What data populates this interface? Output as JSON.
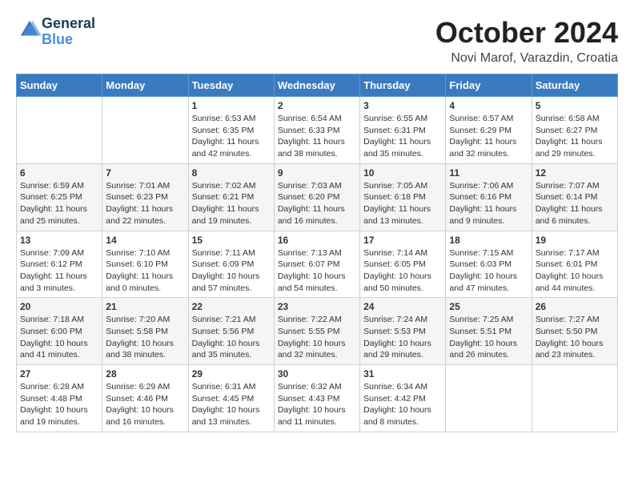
{
  "logo": {
    "text_general": "General",
    "text_blue": "Blue"
  },
  "header": {
    "month": "October 2024",
    "location": "Novi Marof, Varazdin, Croatia"
  },
  "weekdays": [
    "Sunday",
    "Monday",
    "Tuesday",
    "Wednesday",
    "Thursday",
    "Friday",
    "Saturday"
  ],
  "weeks": [
    [
      {
        "day": "",
        "sunrise": "",
        "sunset": "",
        "daylight": ""
      },
      {
        "day": "",
        "sunrise": "",
        "sunset": "",
        "daylight": ""
      },
      {
        "day": "1",
        "sunrise": "Sunrise: 6:53 AM",
        "sunset": "Sunset: 6:35 PM",
        "daylight": "Daylight: 11 hours and 42 minutes."
      },
      {
        "day": "2",
        "sunrise": "Sunrise: 6:54 AM",
        "sunset": "Sunset: 6:33 PM",
        "daylight": "Daylight: 11 hours and 38 minutes."
      },
      {
        "day": "3",
        "sunrise": "Sunrise: 6:55 AM",
        "sunset": "Sunset: 6:31 PM",
        "daylight": "Daylight: 11 hours and 35 minutes."
      },
      {
        "day": "4",
        "sunrise": "Sunrise: 6:57 AM",
        "sunset": "Sunset: 6:29 PM",
        "daylight": "Daylight: 11 hours and 32 minutes."
      },
      {
        "day": "5",
        "sunrise": "Sunrise: 6:58 AM",
        "sunset": "Sunset: 6:27 PM",
        "daylight": "Daylight: 11 hours and 29 minutes."
      }
    ],
    [
      {
        "day": "6",
        "sunrise": "Sunrise: 6:59 AM",
        "sunset": "Sunset: 6:25 PM",
        "daylight": "Daylight: 11 hours and 25 minutes."
      },
      {
        "day": "7",
        "sunrise": "Sunrise: 7:01 AM",
        "sunset": "Sunset: 6:23 PM",
        "daylight": "Daylight: 11 hours and 22 minutes."
      },
      {
        "day": "8",
        "sunrise": "Sunrise: 7:02 AM",
        "sunset": "Sunset: 6:21 PM",
        "daylight": "Daylight: 11 hours and 19 minutes."
      },
      {
        "day": "9",
        "sunrise": "Sunrise: 7:03 AM",
        "sunset": "Sunset: 6:20 PM",
        "daylight": "Daylight: 11 hours and 16 minutes."
      },
      {
        "day": "10",
        "sunrise": "Sunrise: 7:05 AM",
        "sunset": "Sunset: 6:18 PM",
        "daylight": "Daylight: 11 hours and 13 minutes."
      },
      {
        "day": "11",
        "sunrise": "Sunrise: 7:06 AM",
        "sunset": "Sunset: 6:16 PM",
        "daylight": "Daylight: 11 hours and 9 minutes."
      },
      {
        "day": "12",
        "sunrise": "Sunrise: 7:07 AM",
        "sunset": "Sunset: 6:14 PM",
        "daylight": "Daylight: 11 hours and 6 minutes."
      }
    ],
    [
      {
        "day": "13",
        "sunrise": "Sunrise: 7:09 AM",
        "sunset": "Sunset: 6:12 PM",
        "daylight": "Daylight: 11 hours and 3 minutes."
      },
      {
        "day": "14",
        "sunrise": "Sunrise: 7:10 AM",
        "sunset": "Sunset: 6:10 PM",
        "daylight": "Daylight: 11 hours and 0 minutes."
      },
      {
        "day": "15",
        "sunrise": "Sunrise: 7:11 AM",
        "sunset": "Sunset: 6:09 PM",
        "daylight": "Daylight: 10 hours and 57 minutes."
      },
      {
        "day": "16",
        "sunrise": "Sunrise: 7:13 AM",
        "sunset": "Sunset: 6:07 PM",
        "daylight": "Daylight: 10 hours and 54 minutes."
      },
      {
        "day": "17",
        "sunrise": "Sunrise: 7:14 AM",
        "sunset": "Sunset: 6:05 PM",
        "daylight": "Daylight: 10 hours and 50 minutes."
      },
      {
        "day": "18",
        "sunrise": "Sunrise: 7:15 AM",
        "sunset": "Sunset: 6:03 PM",
        "daylight": "Daylight: 10 hours and 47 minutes."
      },
      {
        "day": "19",
        "sunrise": "Sunrise: 7:17 AM",
        "sunset": "Sunset: 6:01 PM",
        "daylight": "Daylight: 10 hours and 44 minutes."
      }
    ],
    [
      {
        "day": "20",
        "sunrise": "Sunrise: 7:18 AM",
        "sunset": "Sunset: 6:00 PM",
        "daylight": "Daylight: 10 hours and 41 minutes."
      },
      {
        "day": "21",
        "sunrise": "Sunrise: 7:20 AM",
        "sunset": "Sunset: 5:58 PM",
        "daylight": "Daylight: 10 hours and 38 minutes."
      },
      {
        "day": "22",
        "sunrise": "Sunrise: 7:21 AM",
        "sunset": "Sunset: 5:56 PM",
        "daylight": "Daylight: 10 hours and 35 minutes."
      },
      {
        "day": "23",
        "sunrise": "Sunrise: 7:22 AM",
        "sunset": "Sunset: 5:55 PM",
        "daylight": "Daylight: 10 hours and 32 minutes."
      },
      {
        "day": "24",
        "sunrise": "Sunrise: 7:24 AM",
        "sunset": "Sunset: 5:53 PM",
        "daylight": "Daylight: 10 hours and 29 minutes."
      },
      {
        "day": "25",
        "sunrise": "Sunrise: 7:25 AM",
        "sunset": "Sunset: 5:51 PM",
        "daylight": "Daylight: 10 hours and 26 minutes."
      },
      {
        "day": "26",
        "sunrise": "Sunrise: 7:27 AM",
        "sunset": "Sunset: 5:50 PM",
        "daylight": "Daylight: 10 hours and 23 minutes."
      }
    ],
    [
      {
        "day": "27",
        "sunrise": "Sunrise: 6:28 AM",
        "sunset": "Sunset: 4:48 PM",
        "daylight": "Daylight: 10 hours and 19 minutes."
      },
      {
        "day": "28",
        "sunrise": "Sunrise: 6:29 AM",
        "sunset": "Sunset: 4:46 PM",
        "daylight": "Daylight: 10 hours and 16 minutes."
      },
      {
        "day": "29",
        "sunrise": "Sunrise: 6:31 AM",
        "sunset": "Sunset: 4:45 PM",
        "daylight": "Daylight: 10 hours and 13 minutes."
      },
      {
        "day": "30",
        "sunrise": "Sunrise: 6:32 AM",
        "sunset": "Sunset: 4:43 PM",
        "daylight": "Daylight: 10 hours and 11 minutes."
      },
      {
        "day": "31",
        "sunrise": "Sunrise: 6:34 AM",
        "sunset": "Sunset: 4:42 PM",
        "daylight": "Daylight: 10 hours and 8 minutes."
      },
      {
        "day": "",
        "sunrise": "",
        "sunset": "",
        "daylight": ""
      },
      {
        "day": "",
        "sunrise": "",
        "sunset": "",
        "daylight": ""
      }
    ]
  ]
}
